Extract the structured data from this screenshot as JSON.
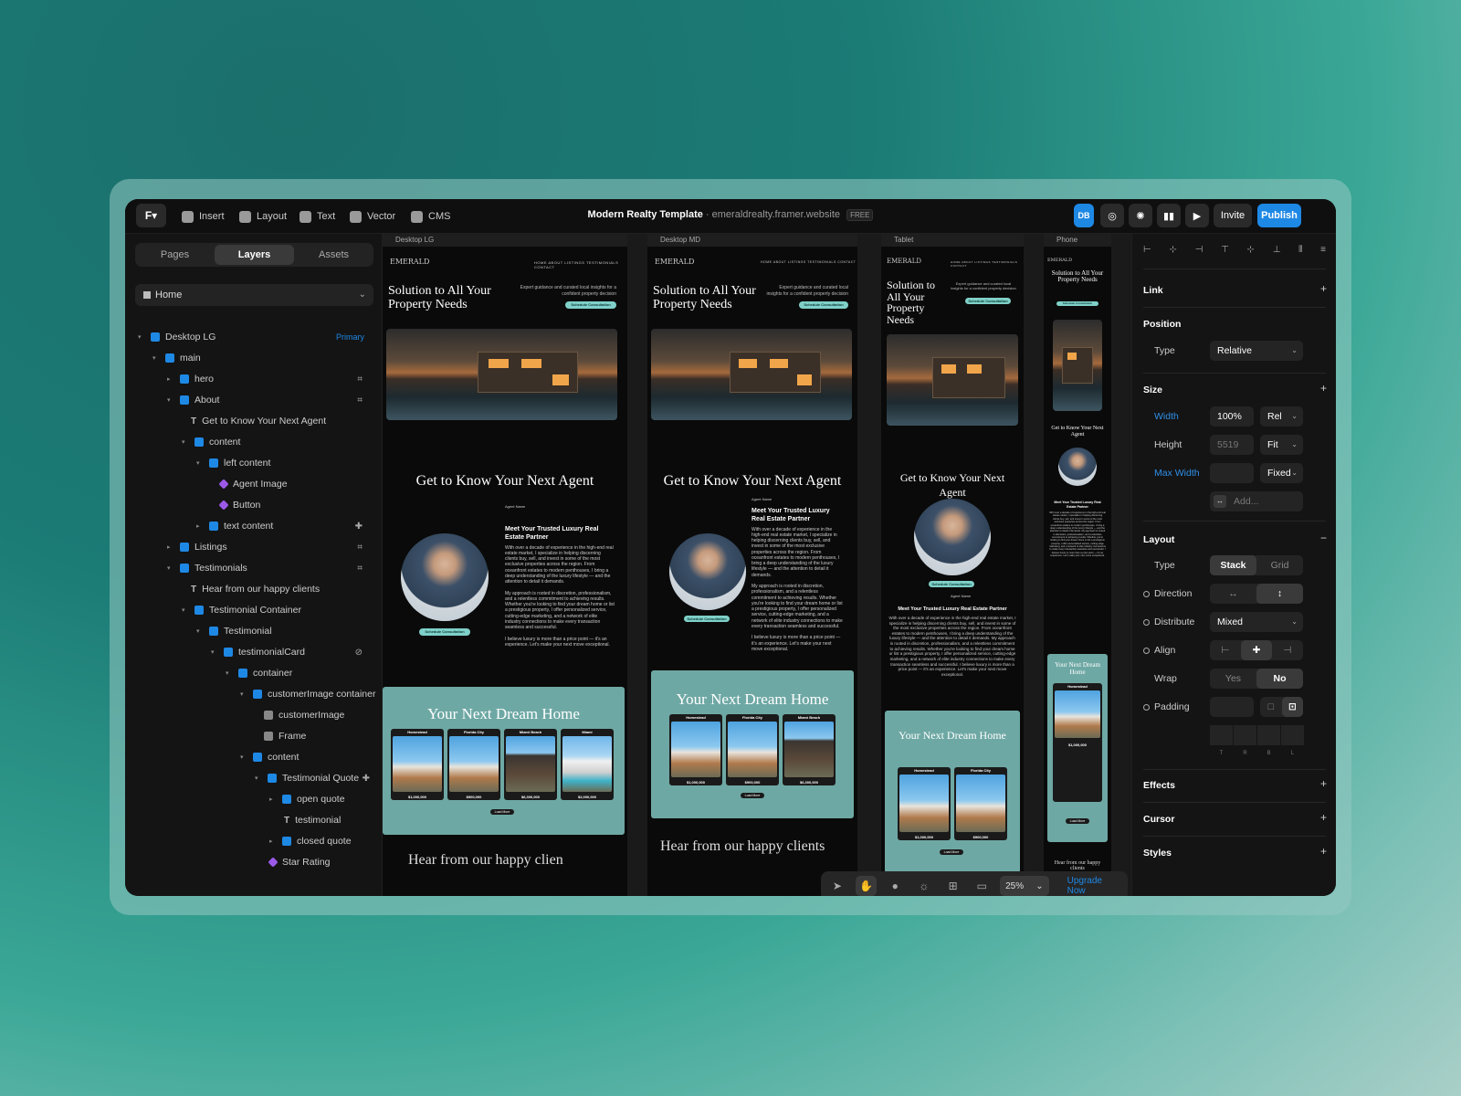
{
  "topbar": {
    "insert": "Insert",
    "layout": "Layout",
    "text": "Text",
    "vector": "Vector",
    "cms": "CMS",
    "project_title": "Modern Realty Template",
    "project_url": "· emeraldrealty.framer.website",
    "plan_badge": "FREE",
    "avatar": "DB",
    "invite": "Invite",
    "publish": "Publish",
    "accent": "#1e88e5"
  },
  "left_panel": {
    "tabs": [
      "Pages",
      "Layers",
      "Assets"
    ],
    "active_tab": "Layers",
    "page": "Home",
    "layers": [
      {
        "label": "Desktop LG",
        "tag": "Primary"
      },
      {
        "label": "main"
      },
      {
        "label": "hero"
      },
      {
        "label": "About"
      },
      {
        "label": "Get to Know Your Next Agent"
      },
      {
        "label": "content"
      },
      {
        "label": "left content"
      },
      {
        "label": "Agent Image"
      },
      {
        "label": "Button"
      },
      {
        "label": "text content"
      },
      {
        "label": "Listings"
      },
      {
        "label": "Testimonials"
      },
      {
        "label": "Hear from our happy clients"
      },
      {
        "label": "Testimonial Container"
      },
      {
        "label": "Testimonial"
      },
      {
        "label": "testimonialCard"
      },
      {
        "label": "container"
      },
      {
        "label": "customerImage container"
      },
      {
        "label": "customerImage"
      },
      {
        "label": "Frame"
      },
      {
        "label": "content"
      },
      {
        "label": "Testimonial Quote"
      },
      {
        "label": "open quote"
      },
      {
        "label": "testimonial"
      },
      {
        "label": "closed quote"
      },
      {
        "label": "Star Rating"
      }
    ]
  },
  "canvas": {
    "frames": [
      "Desktop LG",
      "Desktop MD",
      "Tablet",
      "Phone"
    ],
    "site": {
      "logo": "EMERALD",
      "nav": "HOME   ABOUT   LISTINGS   TESTIMONIALS   CONTACT",
      "hero_title": "Solution to All Your Property Needs",
      "hero_sub": "Expert guidance and curated local insights for a confident property decision",
      "cta": "Schedule Consultation",
      "about_title": "Get to Know Your Next Agent",
      "agent_name": "Agent Name",
      "agent_heading": "Meet Your Trusted Luxury Real Estate Partner",
      "agent_body": "With over a decade of experience in the high-end real estate market, I specialize in helping discerning clients buy, sell, and invest in some of the most exclusive properties across the region. From oceanfront estates to modern penthouses, I bring a deep understanding of the luxury lifestyle — and the attention to detail it demands.",
      "agent_body2": "My approach is rooted in discretion, professionalism, and a relentless commitment to achieving results. Whether you're looking to find your dream home or list a prestigious property, I offer personalized service, cutting-edge marketing, and a network of elite industry connections to make every transaction seamless and successful.",
      "agent_body3": "I believe luxury is more than a price point — it's an experience. Let's make your next move exceptional.",
      "listings_title": "Your Next Dream Home",
      "listings": [
        {
          "city": "Homestead",
          "price": "$1,000,000"
        },
        {
          "city": "Florida City",
          "price": "$900,000"
        },
        {
          "city": "Miami Beach",
          "price": "$6,300,000"
        },
        {
          "city": "Miami",
          "price": "$2,000,000"
        }
      ],
      "load_more": "Load More",
      "testimonials_title": "Hear from our happy clients",
      "teal": "#6ea8a4"
    },
    "toolbar": {
      "zoom": "25%",
      "upgrade": "Upgrade Now"
    }
  },
  "right_panel": {
    "link": "Link",
    "position": "Position",
    "position_type_label": "Type",
    "position_type": "Relative",
    "size": "Size",
    "width_label": "Width",
    "width_value": "100%",
    "width_unit": "Rel",
    "height_label": "Height",
    "height_value": "5519",
    "height_unit": "Fit",
    "maxwidth_label": "Max Width",
    "maxwidth_unit": "Fixed",
    "add": "Add...",
    "layout": "Layout",
    "layout_type_label": "Type",
    "layout_types": [
      "Stack",
      "Grid"
    ],
    "layout_type_active": "Stack",
    "direction_label": "Direction",
    "distribute_label": "Distribute",
    "distribute_value": "Mixed",
    "align_label": "Align",
    "wrap_label": "Wrap",
    "wrap_options": [
      "Yes",
      "No"
    ],
    "wrap_active": "No",
    "padding_label": "Padding",
    "padding_sides": [
      "T",
      "R",
      "B",
      "L"
    ],
    "effects": "Effects",
    "cursor": "Cursor",
    "styles": "Styles"
  }
}
